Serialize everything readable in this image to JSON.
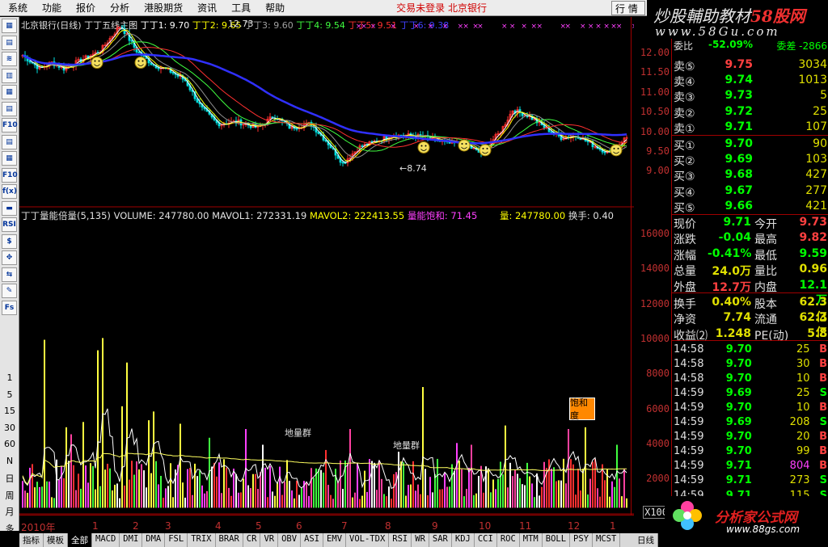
{
  "menu": {
    "items": [
      "系统",
      "功能",
      "报价",
      "分析",
      "港股期货",
      "资讯",
      "工具",
      "帮助"
    ],
    "status": "交易未登录  北京银行",
    "trade_btn": "行 情"
  },
  "banner": {
    "line1_a": "炒股輔助教材",
    "line1_b": "58股网",
    "line2": "www.58Gu.com"
  },
  "toolbar": {
    "buttons": [
      "▦",
      "▤",
      "≋",
      "▥",
      "▦",
      "▤",
      "F10",
      "▤",
      "▦",
      "F10",
      "f(x)",
      "▬",
      "RSI",
      "$",
      "✥",
      "⇆",
      "✎",
      "Fs"
    ],
    "periods": [
      "1",
      "5",
      "15",
      "30",
      "60",
      "N",
      "日",
      "周",
      "月",
      "多"
    ]
  },
  "main_header": {
    "title": "北京银行(日线) 丁丁五线主图",
    "ma1": "丁丁1: 9.70",
    "ma2": "丁丁2: 9.65",
    "ma3": "丁丁3: 9.60",
    "ma4": "丁丁4: 9.54",
    "ma5": "丁丁5: 9.51",
    "ma6": "丁丁6: 9.38"
  },
  "price_axis": [
    "12.00",
    "11.50",
    "11.00",
    "10.50",
    "10.00",
    "9.50",
    "9.00"
  ],
  "price_notes": {
    "high": "12.73",
    "low": "←8.74"
  },
  "vol_header": {
    "title": "丁丁量能倍量(5,135)",
    "volume": "VOLUME: 247780.00",
    "mavol1": "MAVOL1: 272331.19",
    "mavol2": "MAVOL2: 222413.55",
    "saturation": "量能饱和: 71.45",
    "liang": "量: 247780.00",
    "huanshou": "换手: 0.40"
  },
  "vol_axis": [
    "16000",
    "14000",
    "12000",
    "10000",
    "8000",
    "6000",
    "4000",
    "2000"
  ],
  "vol_notes": {
    "a": "地量群",
    "b": "地量群",
    "sat": "饱和度",
    "x100": "X100"
  },
  "months": [
    "2010年",
    "1",
    "2",
    "3",
    "4",
    "5",
    "6",
    "7",
    "8",
    "9",
    "10",
    "11",
    "12",
    "1"
  ],
  "bottom": {
    "tabs": [
      "指标",
      "模板",
      "全部",
      "MACD",
      "DMI",
      "DMA",
      "FSL",
      "TRIX",
      "BRAR",
      "CR",
      "VR",
      "OBV",
      "ASI",
      "EMV",
      "VOL-TDX",
      "RSI",
      "WR",
      "SAR",
      "KDJ",
      "CCI",
      "ROC",
      "MTM",
      "BOLL",
      "PSY",
      "MCST"
    ],
    "period": "日线"
  },
  "orderbook": {
    "top_partial": {
      "label": "委比",
      "value": "-52.09%",
      "label2": "委差",
      "value2": "-2866"
    },
    "sells": [
      {
        "l": "卖⑤",
        "p": "9.75",
        "v": "3034"
      },
      {
        "l": "卖④",
        "p": "9.74",
        "v": "1013"
      },
      {
        "l": "卖③",
        "p": "9.73",
        "v": "5"
      },
      {
        "l": "卖②",
        "p": "9.72",
        "v": "25"
      },
      {
        "l": "卖①",
        "p": "9.71",
        "v": "107"
      }
    ],
    "buys": [
      {
        "l": "买①",
        "p": "9.70",
        "v": "90"
      },
      {
        "l": "买②",
        "p": "9.69",
        "v": "103"
      },
      {
        "l": "买③",
        "p": "9.68",
        "v": "427"
      },
      {
        "l": "买④",
        "p": "9.67",
        "v": "277"
      },
      {
        "l": "买⑤",
        "p": "9.66",
        "v": "421"
      }
    ]
  },
  "quote": [
    {
      "l": "现价",
      "v": "9.71",
      "c": "#00ff00",
      "l2": "今开",
      "v2": "9.73",
      "c2": "#ff4040"
    },
    {
      "l": "涨跌",
      "v": "-0.04",
      "c": "#00ff00",
      "l2": "最高",
      "v2": "9.82",
      "c2": "#ff4040"
    },
    {
      "l": "涨幅",
      "v": "-0.41%",
      "c": "#00ff00",
      "l2": "最低",
      "v2": "9.59",
      "c2": "#00ff00"
    },
    {
      "l": "总量",
      "v": "24.0万",
      "c": "#e0e000",
      "l2": "量比",
      "v2": "0.96",
      "c2": "#e0e000"
    },
    {
      "l": "外盘",
      "v": "12.7万",
      "c": "#ff4040",
      "l2": "内盘",
      "v2": "12.1万",
      "c2": "#00ff00"
    },
    {
      "l": "换手",
      "v": "0.40%",
      "c": "#e0e000",
      "l2": "股本",
      "v2": "62.3亿",
      "c2": "#e0e000"
    },
    {
      "l": "净资",
      "v": "7.74",
      "c": "#e0e000",
      "l2": "流通",
      "v2": "62.3亿",
      "c2": "#e0e000"
    },
    {
      "l": "收益⑵",
      "v": "1.248",
      "c": "#e0e000",
      "l2": "PE(动)",
      "v2": "5.8",
      "c2": "#e0e000"
    }
  ],
  "ticks": [
    {
      "t": "14:58",
      "p": "9.70",
      "v": "25",
      "s": "B"
    },
    {
      "t": "14:58",
      "p": "9.70",
      "v": "30",
      "s": "B"
    },
    {
      "t": "14:58",
      "p": "9.70",
      "v": "10",
      "s": "B"
    },
    {
      "t": "14:59",
      "p": "9.69",
      "v": "25",
      "s": "S"
    },
    {
      "t": "14:59",
      "p": "9.70",
      "v": "10",
      "s": "B"
    },
    {
      "t": "14:59",
      "p": "9.69",
      "v": "208",
      "s": "S"
    },
    {
      "t": "14:59",
      "p": "9.70",
      "v": "20",
      "s": "B"
    },
    {
      "t": "14:59",
      "p": "9.70",
      "v": "99",
      "s": "B"
    },
    {
      "t": "14:59",
      "p": "9.71",
      "v": "804",
      "s": "B"
    },
    {
      "t": "14:59",
      "p": "9.71",
      "v": "273",
      "s": "S"
    },
    {
      "t": "14:59",
      "p": "9.71",
      "v": "115",
      "s": "S"
    }
  ],
  "footlogo": {
    "t1": "分析家公式网",
    "t2": "www.88gs.com"
  },
  "colors": {
    "up": "#ff4040",
    "down": "#00ff00",
    "ma_blue": "#2020ff",
    "axis": "#a00000"
  }
}
